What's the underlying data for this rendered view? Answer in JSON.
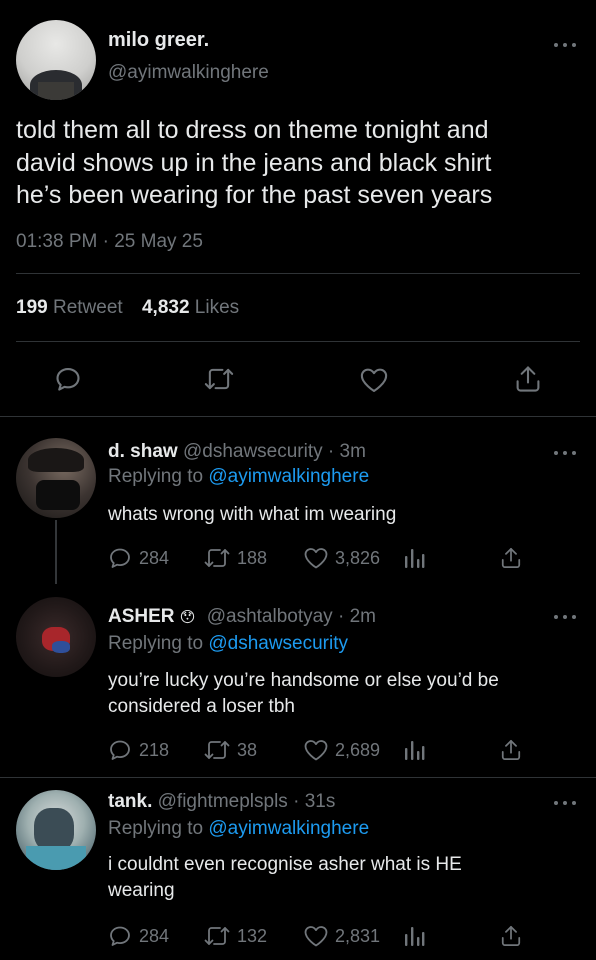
{
  "main_tweet": {
    "display_name": "milo greer.",
    "handle": "@ayimwalkinghere",
    "text_lines": [
      "told them all to dress on theme tonight and",
      "david shows up in the jeans and black shirt",
      "he’s been wearing for the past seven years"
    ],
    "timestamp": "01:38 PM · 25 May 25",
    "retweet_count": "199",
    "retweet_label": "Retweet",
    "likes_count": "4,832",
    "likes_label": "Likes"
  },
  "replies": [
    {
      "display_name": "d. shaw",
      "handle": "@dshawsecurity",
      "time": "· 3m",
      "replying_prefix": "Replying to",
      "replying_to": "@ayimwalkinghere",
      "text_lines": [
        "whats wrong with what im wearing"
      ],
      "reply_count": "284",
      "retweet_count": "188",
      "like_count": "3,826"
    },
    {
      "display_name": "ASHER",
      "emoji": "😯",
      "handle": "@ashtalbotyay",
      "time": "· 2m",
      "replying_prefix": "Replying to",
      "replying_to": "@dshawsecurity",
      "text_lines": [
        "you’re lucky you’re handsome or else you’d be",
        "considered a loser tbh"
      ],
      "reply_count": "218",
      "retweet_count": "38",
      "like_count": "2,689"
    },
    {
      "display_name": "tank.",
      "handle": "@fightmeplspls",
      "time": "· 31s",
      "replying_prefix": "Replying to",
      "replying_to": "@ayimwalkinghere",
      "text_lines": [
        "i couldnt even recognise asher what is HE",
        "wearing"
      ],
      "reply_count": "284",
      "retweet_count": "132",
      "like_count": "2,831"
    }
  ],
  "colors": {
    "background": "#000000",
    "text": "#e7e9ea",
    "muted": "#71767b",
    "link": "#1d9bf0",
    "divider": "#2f3336"
  }
}
